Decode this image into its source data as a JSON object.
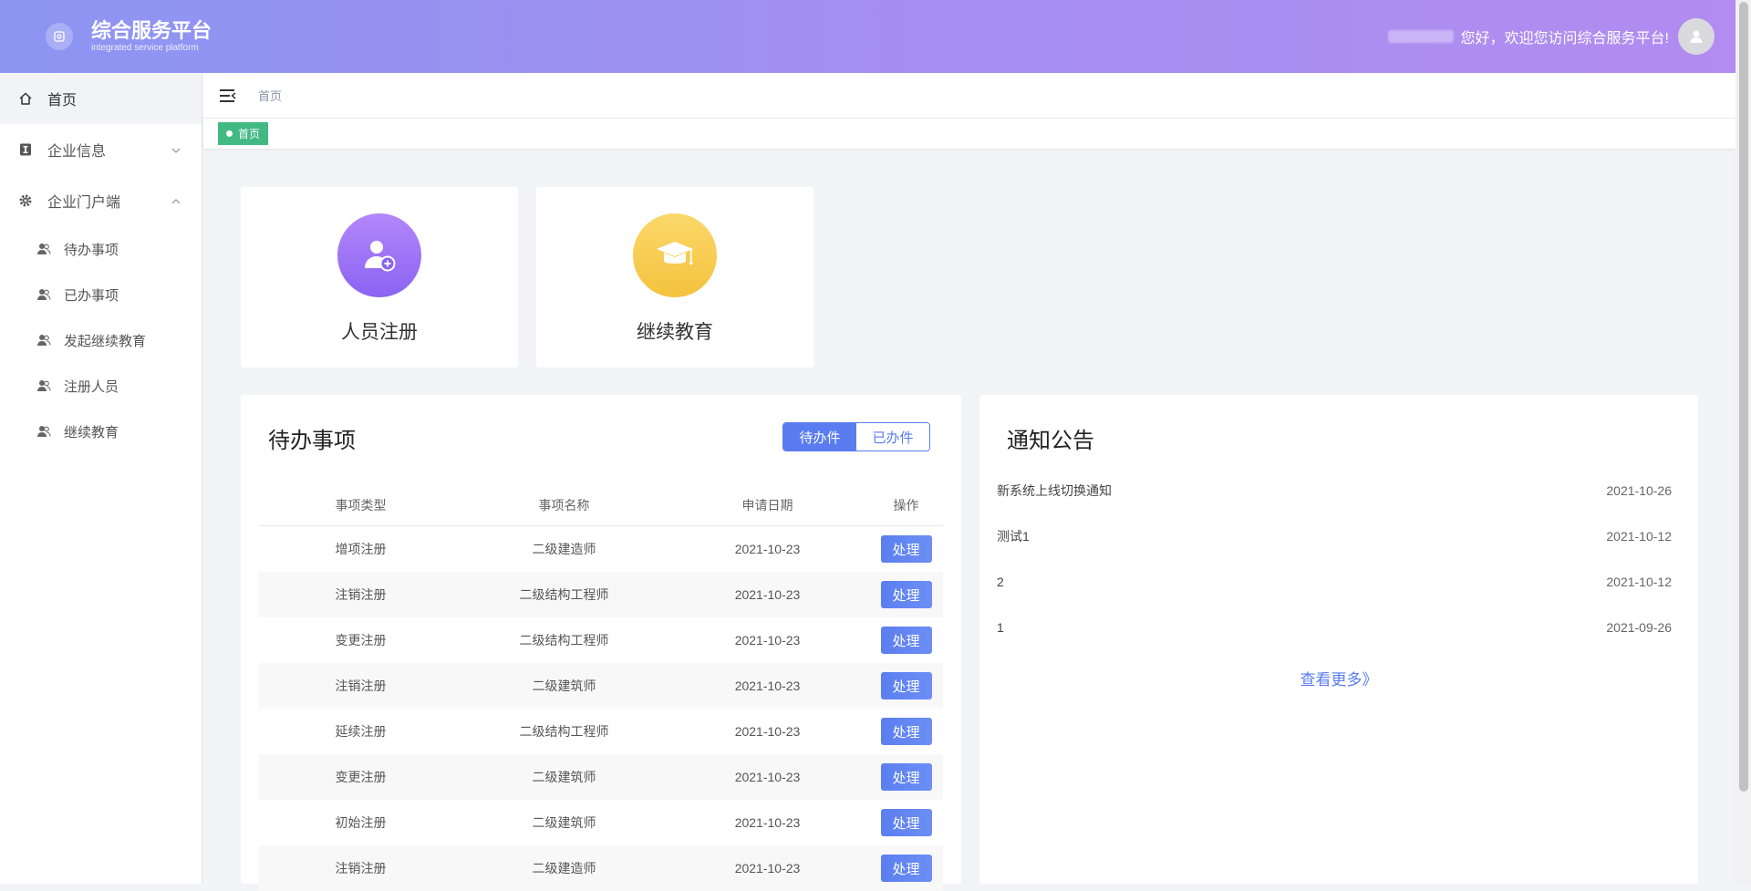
{
  "header": {
    "title": "综合服务平台",
    "subtitle": "integrated service platform",
    "welcome": "您好，欢迎您访问综合服务平台!"
  },
  "sidebar": {
    "items": [
      {
        "label": "首页",
        "icon": "home-icon"
      },
      {
        "label": "企业信息",
        "icon": "info-icon"
      },
      {
        "label": "企业门户端",
        "icon": "gear-icon"
      }
    ],
    "subitems": [
      {
        "label": "待办事项"
      },
      {
        "label": "已办事项"
      },
      {
        "label": "发起继续教育"
      },
      {
        "label": "注册人员"
      },
      {
        "label": "继续教育"
      }
    ]
  },
  "breadcrumb": "首页",
  "tag": "首页",
  "quick": {
    "register": "人员注册",
    "education": "继续教育"
  },
  "colors": {
    "register_circle": "#9a6ff5",
    "education_circle": "#f7c94a",
    "accent": "#5a7cf0",
    "tag": "#42b983"
  },
  "todo": {
    "title": "待办事项",
    "toggle_pending": "待办件",
    "toggle_done": "已办件",
    "headers": [
      "事项类型",
      "事项名称",
      "申请日期",
      "操作"
    ],
    "action_label": "处理",
    "rows": [
      {
        "type": "增项注册",
        "name": "二级建造师",
        "date": "2021-10-23"
      },
      {
        "type": "注销注册",
        "name": "二级结构工程师",
        "date": "2021-10-23"
      },
      {
        "type": "变更注册",
        "name": "二级结构工程师",
        "date": "2021-10-23"
      },
      {
        "type": "注销注册",
        "name": "二级建筑师",
        "date": "2021-10-23"
      },
      {
        "type": "延续注册",
        "name": "二级结构工程师",
        "date": "2021-10-23"
      },
      {
        "type": "变更注册",
        "name": "二级建筑师",
        "date": "2021-10-23"
      },
      {
        "type": "初始注册",
        "name": "二级建筑师",
        "date": "2021-10-23"
      },
      {
        "type": "注销注册",
        "name": "二级建造师",
        "date": "2021-10-23"
      }
    ]
  },
  "notice": {
    "title": "通知公告",
    "items": [
      {
        "title": "新系统上线切换通知",
        "date": "2021-10-26"
      },
      {
        "title": "测试1",
        "date": "2021-10-12"
      },
      {
        "title": "2",
        "date": "2021-10-12"
      },
      {
        "title": "1",
        "date": "2021-09-26"
      }
    ],
    "more": "查看更多》"
  }
}
